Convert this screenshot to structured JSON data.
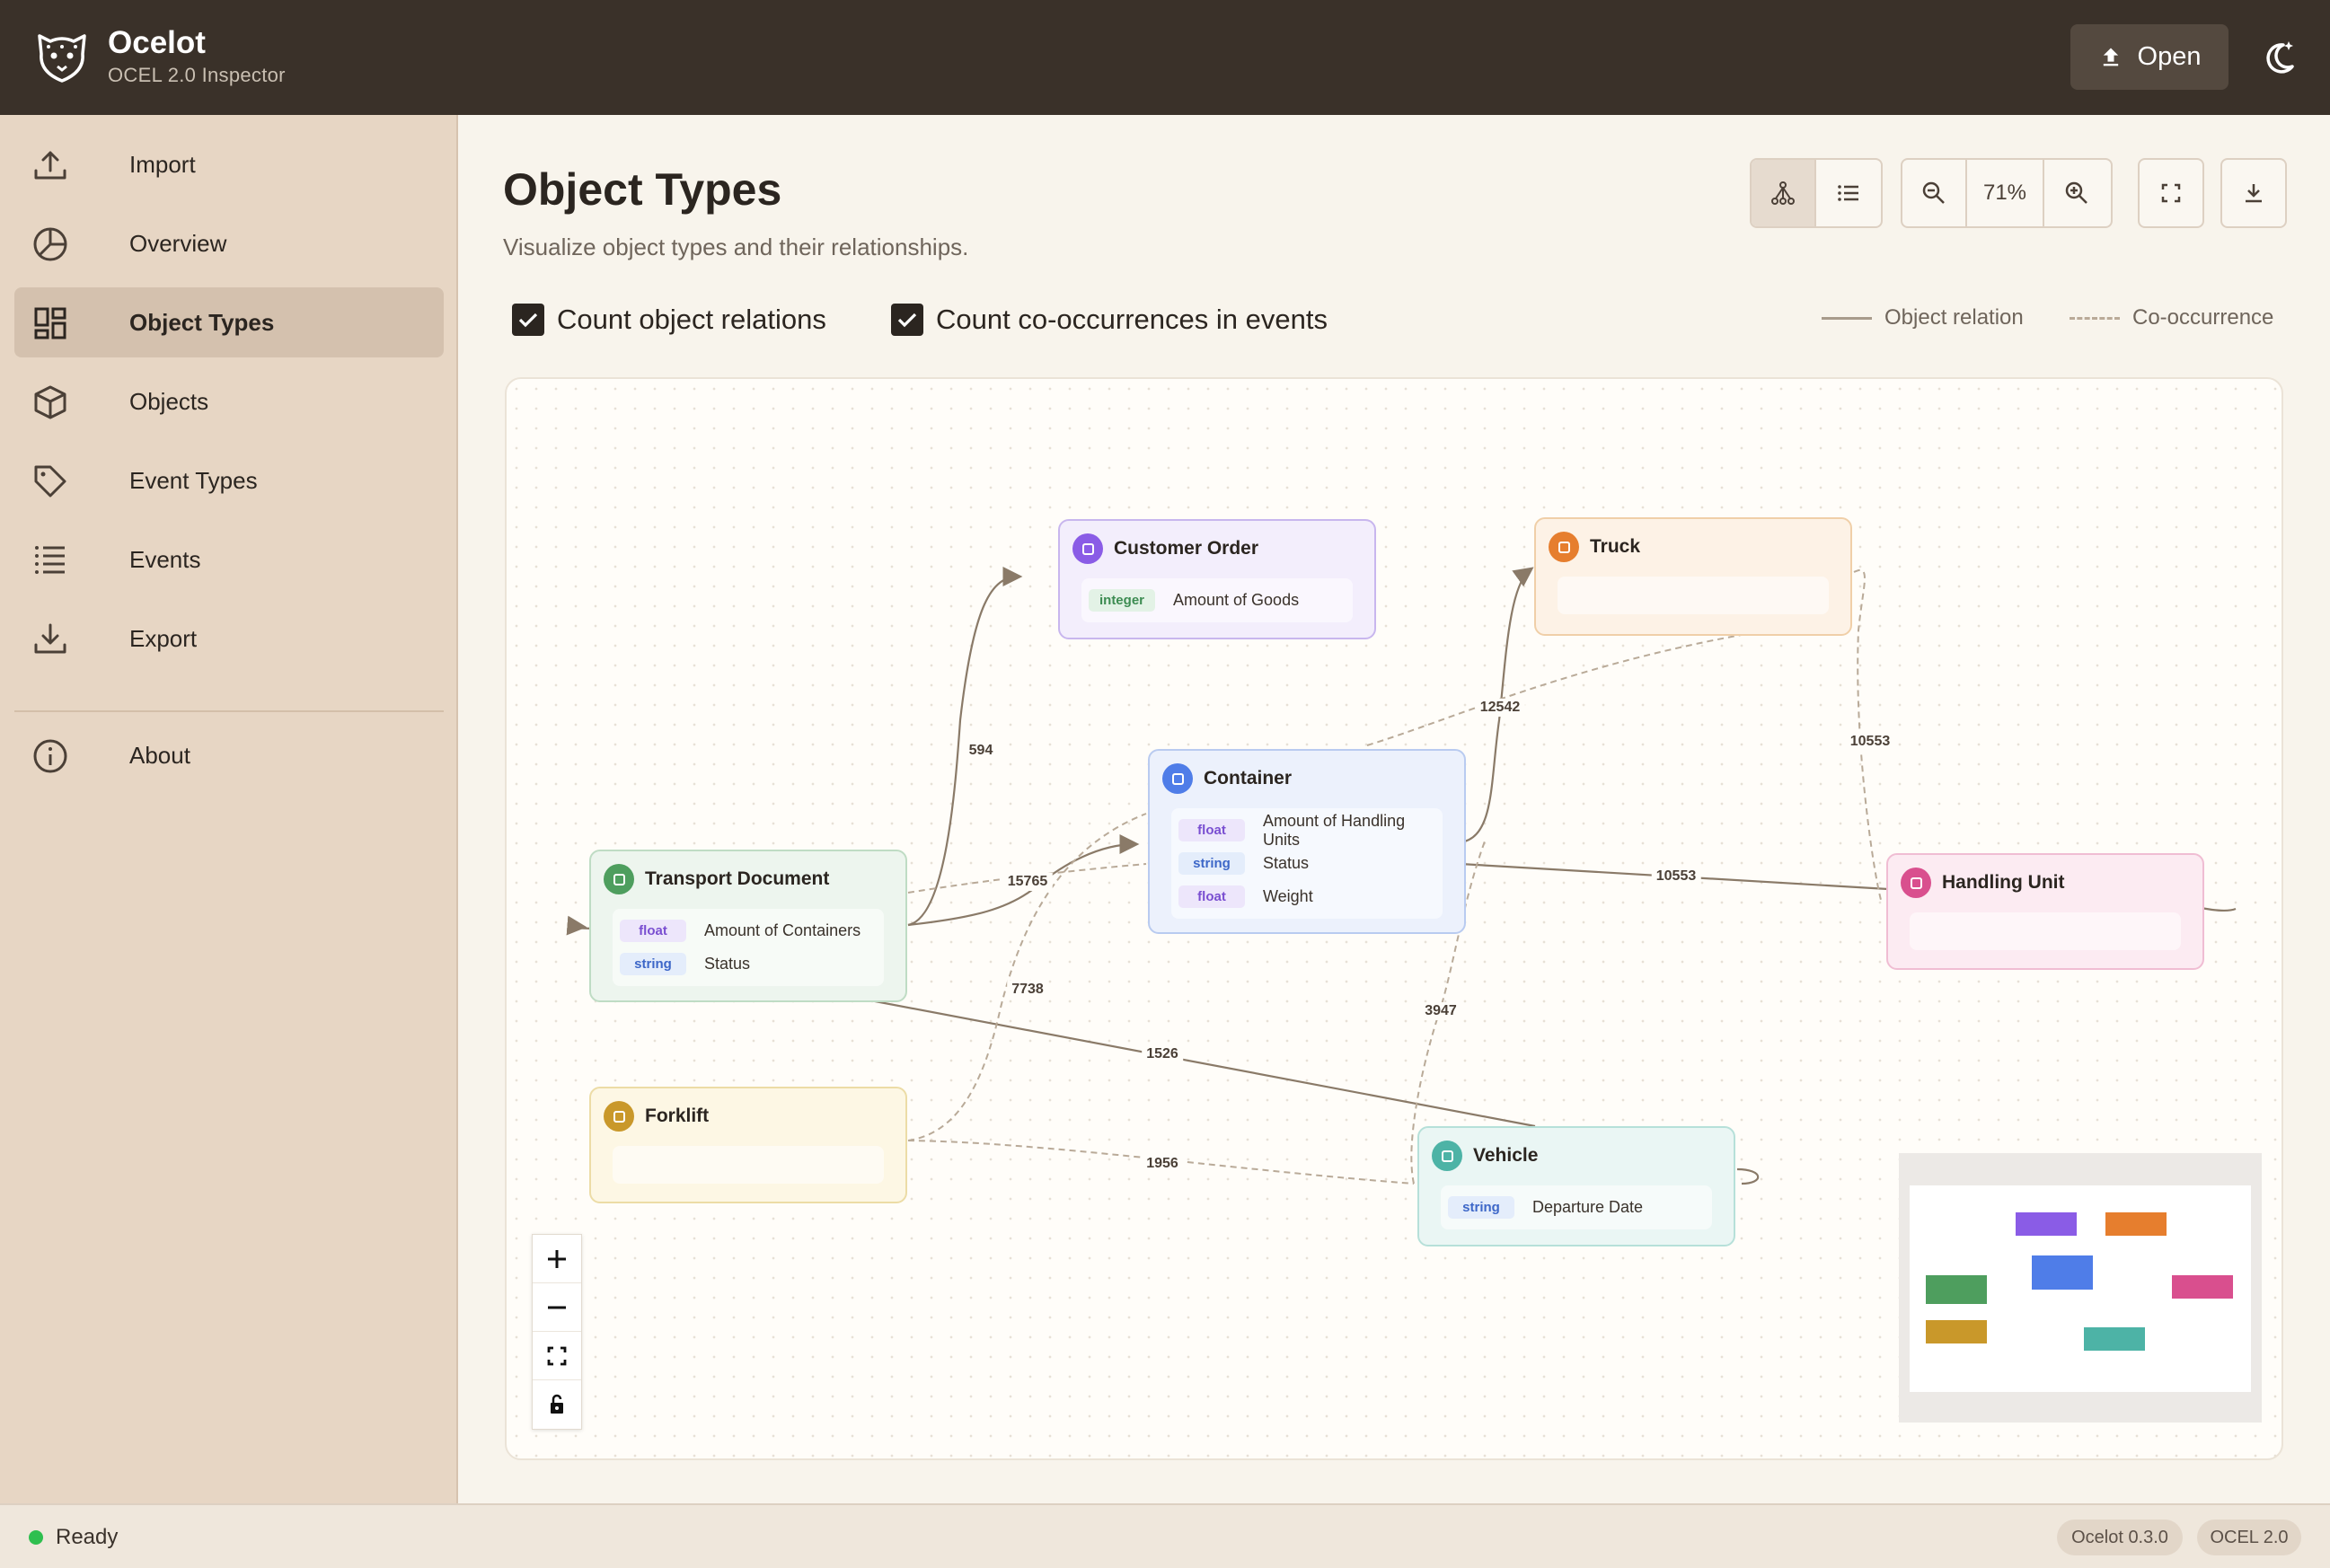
{
  "app": {
    "title": "Ocelot",
    "subtitle": "OCEL 2.0 Inspector",
    "open_label": "Open"
  },
  "sidebar": {
    "items": [
      {
        "label": "Import",
        "icon": "upload-icon"
      },
      {
        "label": "Overview",
        "icon": "pie-chart-icon"
      },
      {
        "label": "Object Types",
        "icon": "dashboard-icon",
        "active": true
      },
      {
        "label": "Objects",
        "icon": "cube-icon"
      },
      {
        "label": "Event Types",
        "icon": "tag-icon"
      },
      {
        "label": "Events",
        "icon": "list-icon"
      },
      {
        "label": "Export",
        "icon": "download-icon"
      }
    ],
    "about": {
      "label": "About",
      "icon": "info-icon"
    }
  },
  "page": {
    "title": "Object Types",
    "subtitle": "Visualize object types and their relationships."
  },
  "toolbar": {
    "zoom": "71%"
  },
  "options": {
    "count_relations": "Count object relations",
    "count_cooccurrence": "Count co-occurrences in events"
  },
  "legend": {
    "relation": "Object relation",
    "cooccurrence": "Co-occurrence"
  },
  "graph": {
    "nodes": {
      "customer_order": {
        "name": "Customer Order",
        "color": "#8a5ce6",
        "attributes": [
          {
            "type": "integer",
            "name": "Amount of Goods"
          }
        ]
      },
      "truck": {
        "name": "Truck",
        "color": "#e67e2e",
        "attributes": []
      },
      "container": {
        "name": "Container",
        "color": "#4f7de8",
        "attributes": [
          {
            "type": "float",
            "name": "Amount of Handling Units"
          },
          {
            "type": "string",
            "name": "Status"
          },
          {
            "type": "float",
            "name": "Weight"
          }
        ]
      },
      "transport_document": {
        "name": "Transport Document",
        "color": "#4e9e5e",
        "attributes": [
          {
            "type": "float",
            "name": "Amount of Containers"
          },
          {
            "type": "string",
            "name": "Status"
          }
        ]
      },
      "handling_unit": {
        "name": "Handling Unit",
        "color": "#d94f8e",
        "attributes": []
      },
      "forklift": {
        "name": "Forklift",
        "color": "#c9982a",
        "attributes": []
      },
      "vehicle": {
        "name": "Vehicle",
        "color": "#4db3a6",
        "attributes": [
          {
            "type": "string",
            "name": "Departure Date"
          }
        ]
      }
    },
    "edge_labels": {
      "td_co": "594",
      "td_container": "15765",
      "container_truck": "12542",
      "truck_hu": "10553",
      "container_hu": "10553",
      "forklift_container": "7738",
      "td_vehicle": "1526",
      "vehicle_container": "3947",
      "forklift_vehicle": "1956"
    }
  },
  "footer": {
    "status": "Ready",
    "version": "Ocelot 0.3.0",
    "format": "OCEL 2.0"
  }
}
